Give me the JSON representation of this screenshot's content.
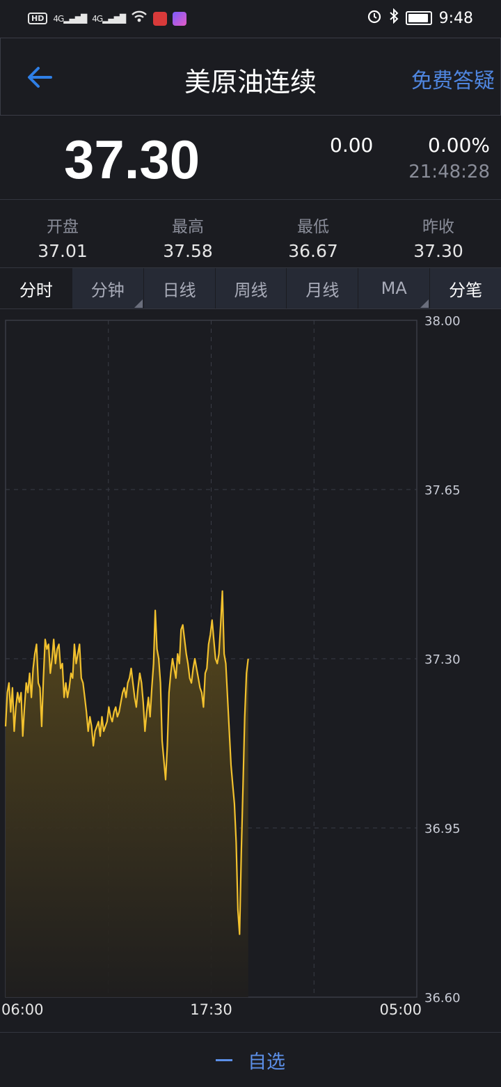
{
  "status_bar": {
    "hd": "HD",
    "signal1": "4G",
    "signal2": "4G",
    "time": "9:48",
    "icons": [
      "hd-icon",
      "signal-icon",
      "wifi-icon",
      "app-icon",
      "app-icon",
      "alarm-icon",
      "bluetooth-icon",
      "battery-icon"
    ]
  },
  "header": {
    "title": "美原油连续",
    "help": "免费答疑"
  },
  "quote": {
    "price": "37.30",
    "change": "0.00",
    "change_pct": "0.00%",
    "time": "21:48:28"
  },
  "stats": [
    {
      "label": "开盘",
      "value": "37.01"
    },
    {
      "label": "最高",
      "value": "37.58"
    },
    {
      "label": "最低",
      "value": "36.67"
    },
    {
      "label": "昨收",
      "value": "37.30"
    }
  ],
  "tabs": [
    {
      "label": "分时",
      "active": true,
      "dropdown": false
    },
    {
      "label": "分钟",
      "active": false,
      "dropdown": true
    },
    {
      "label": "日线",
      "active": false,
      "dropdown": false
    },
    {
      "label": "周线",
      "active": false,
      "dropdown": false
    },
    {
      "label": "月线",
      "active": false,
      "dropdown": false
    },
    {
      "label": "MA",
      "active": false,
      "dropdown": true
    },
    {
      "label": "分笔",
      "active": false,
      "dropdown": false
    }
  ],
  "bottom": {
    "favorite_label": "自选"
  },
  "colors": {
    "background": "#1b1c21",
    "line": "#f2c12e",
    "accent": "#4f86e0"
  },
  "chart_data": {
    "type": "area",
    "ylim": [
      36.6,
      38.0
    ],
    "y_ticks": [
      "38.00",
      "37.65",
      "37.30",
      "36.95",
      "36.60"
    ],
    "x_ticks": [
      "06:00",
      "17:30",
      "05:00"
    ],
    "session_fraction_completed": 0.59,
    "values": [
      37.16,
      37.23,
      37.25,
      37.19,
      37.24,
      37.15,
      37.2,
      37.23,
      37.21,
      37.23,
      37.14,
      37.2,
      37.25,
      37.23,
      37.27,
      37.22,
      37.28,
      37.31,
      37.33,
      37.25,
      37.24,
      37.16,
      37.26,
      37.34,
      37.32,
      37.33,
      37.27,
      37.3,
      37.34,
      37.29,
      37.32,
      37.33,
      37.28,
      37.29,
      37.22,
      37.25,
      37.22,
      37.24,
      37.27,
      37.26,
      37.33,
      37.29,
      37.31,
      37.33,
      37.26,
      37.25,
      37.22,
      37.19,
      37.15,
      37.18,
      37.16,
      37.12,
      37.15,
      37.16,
      37.17,
      37.14,
      37.18,
      37.15,
      37.16,
      37.17,
      37.2,
      37.18,
      37.17,
      37.19,
      37.2,
      37.18,
      37.19,
      37.21,
      37.23,
      37.24,
      37.22,
      37.25,
      37.26,
      37.28,
      37.25,
      37.22,
      37.2,
      37.24,
      37.27,
      37.25,
      37.21,
      37.15,
      37.19,
      37.22,
      37.18,
      37.24,
      37.29,
      37.4,
      37.32,
      37.3,
      37.25,
      37.13,
      37.09,
      37.05,
      37.12,
      37.23,
      37.27,
      37.3,
      37.28,
      37.26,
      37.31,
      37.29,
      37.36,
      37.37,
      37.34,
      37.31,
      37.29,
      37.26,
      37.25,
      37.28,
      37.3,
      37.28,
      37.26,
      37.24,
      37.23,
      37.2,
      37.27,
      37.28,
      37.33,
      37.35,
      37.38,
      37.34,
      37.3,
      37.29,
      37.31,
      37.37,
      37.44,
      37.31,
      37.29,
      37.22,
      37.15,
      37.08,
      37.04,
      37.0,
      36.92,
      36.78,
      36.73,
      36.9,
      37.04,
      37.18,
      37.27,
      37.3
    ]
  }
}
